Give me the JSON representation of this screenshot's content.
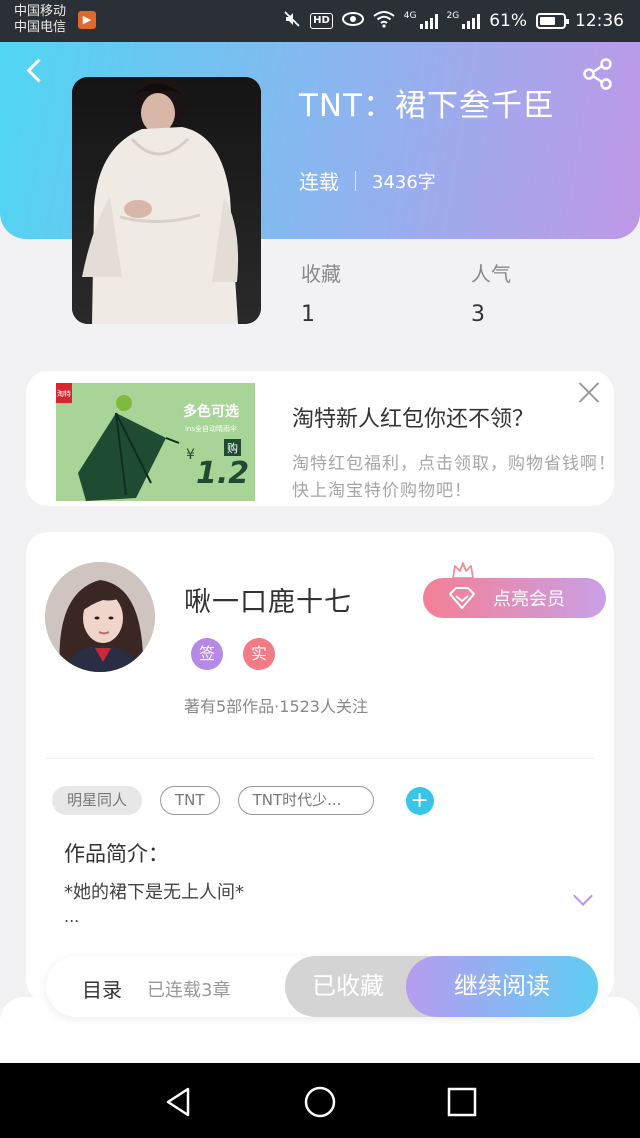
{
  "status_bar": {
    "carrier_1": "中国移动",
    "carrier_2": "中国电信",
    "carrier_badge_icon": "app-notification-icon",
    "hd": "HD",
    "network_1": "4G",
    "network_2": "2G",
    "battery_percent": "61%",
    "time": "12:36"
  },
  "book": {
    "title": "TNT：裙下叁千臣",
    "status": "连载",
    "word_count": "3436字",
    "stats": [
      {
        "label": "收藏",
        "value": "1"
      },
      {
        "label": "人气",
        "value": "3"
      }
    ]
  },
  "ad": {
    "title": "淘特新人红包你还不领？",
    "description": "淘特红包福利，点击领取，购物省钱啊！快上淘宝特价购物吧！",
    "image_text_1": "多色可选",
    "image_text_2": "ins全自动晴雨伞",
    "image_price": "1.2",
    "image_currency": "¥",
    "image_buy": "购",
    "image_logo": "淘特"
  },
  "author": {
    "name": "啾一口鹿十七",
    "vip_label": "点亮会员",
    "badges": [
      {
        "label": "签",
        "color": "#b689e6"
      },
      {
        "label": "实",
        "color": "#f27b86"
      }
    ],
    "meta": "著有5部作品·1523人关注"
  },
  "tags": [
    "明星同人",
    "TNT",
    "TNT时代少..."
  ],
  "intro": {
    "label": "作品简介：",
    "text": "*她的裙下是无上人间*",
    "ellipsis": "..."
  },
  "bottom_bar": {
    "toc": "目录",
    "chapters": "已连载3章",
    "collected": "已收藏",
    "continue": "继续阅读"
  },
  "colors": {
    "header_gradient_start": "#4fd6f3",
    "header_gradient_end": "#bf98e8",
    "accent_cyan": "#37c6ea",
    "vip_pink": "#f47f95"
  }
}
